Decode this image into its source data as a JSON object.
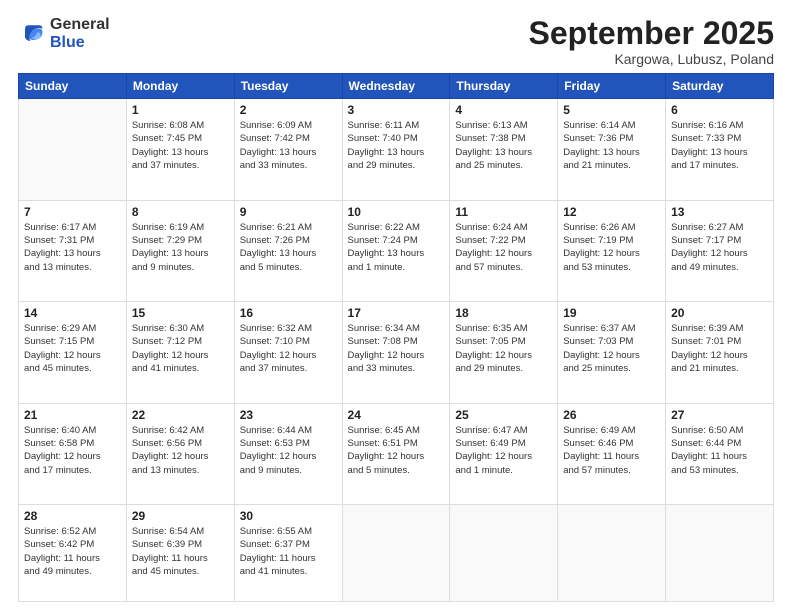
{
  "header": {
    "logo_general": "General",
    "logo_blue": "Blue",
    "month_title": "September 2025",
    "location": "Kargowa, Lubusz, Poland"
  },
  "days_of_week": [
    "Sunday",
    "Monday",
    "Tuesday",
    "Wednesday",
    "Thursday",
    "Friday",
    "Saturday"
  ],
  "weeks": [
    [
      {
        "day": "",
        "info": ""
      },
      {
        "day": "1",
        "info": "Sunrise: 6:08 AM\nSunset: 7:45 PM\nDaylight: 13 hours\nand 37 minutes."
      },
      {
        "day": "2",
        "info": "Sunrise: 6:09 AM\nSunset: 7:42 PM\nDaylight: 13 hours\nand 33 minutes."
      },
      {
        "day": "3",
        "info": "Sunrise: 6:11 AM\nSunset: 7:40 PM\nDaylight: 13 hours\nand 29 minutes."
      },
      {
        "day": "4",
        "info": "Sunrise: 6:13 AM\nSunset: 7:38 PM\nDaylight: 13 hours\nand 25 minutes."
      },
      {
        "day": "5",
        "info": "Sunrise: 6:14 AM\nSunset: 7:36 PM\nDaylight: 13 hours\nand 21 minutes."
      },
      {
        "day": "6",
        "info": "Sunrise: 6:16 AM\nSunset: 7:33 PM\nDaylight: 13 hours\nand 17 minutes."
      }
    ],
    [
      {
        "day": "7",
        "info": "Sunrise: 6:17 AM\nSunset: 7:31 PM\nDaylight: 13 hours\nand 13 minutes."
      },
      {
        "day": "8",
        "info": "Sunrise: 6:19 AM\nSunset: 7:29 PM\nDaylight: 13 hours\nand 9 minutes."
      },
      {
        "day": "9",
        "info": "Sunrise: 6:21 AM\nSunset: 7:26 PM\nDaylight: 13 hours\nand 5 minutes."
      },
      {
        "day": "10",
        "info": "Sunrise: 6:22 AM\nSunset: 7:24 PM\nDaylight: 13 hours\nand 1 minute."
      },
      {
        "day": "11",
        "info": "Sunrise: 6:24 AM\nSunset: 7:22 PM\nDaylight: 12 hours\nand 57 minutes."
      },
      {
        "day": "12",
        "info": "Sunrise: 6:26 AM\nSunset: 7:19 PM\nDaylight: 12 hours\nand 53 minutes."
      },
      {
        "day": "13",
        "info": "Sunrise: 6:27 AM\nSunset: 7:17 PM\nDaylight: 12 hours\nand 49 minutes."
      }
    ],
    [
      {
        "day": "14",
        "info": "Sunrise: 6:29 AM\nSunset: 7:15 PM\nDaylight: 12 hours\nand 45 minutes."
      },
      {
        "day": "15",
        "info": "Sunrise: 6:30 AM\nSunset: 7:12 PM\nDaylight: 12 hours\nand 41 minutes."
      },
      {
        "day": "16",
        "info": "Sunrise: 6:32 AM\nSunset: 7:10 PM\nDaylight: 12 hours\nand 37 minutes."
      },
      {
        "day": "17",
        "info": "Sunrise: 6:34 AM\nSunset: 7:08 PM\nDaylight: 12 hours\nand 33 minutes."
      },
      {
        "day": "18",
        "info": "Sunrise: 6:35 AM\nSunset: 7:05 PM\nDaylight: 12 hours\nand 29 minutes."
      },
      {
        "day": "19",
        "info": "Sunrise: 6:37 AM\nSunset: 7:03 PM\nDaylight: 12 hours\nand 25 minutes."
      },
      {
        "day": "20",
        "info": "Sunrise: 6:39 AM\nSunset: 7:01 PM\nDaylight: 12 hours\nand 21 minutes."
      }
    ],
    [
      {
        "day": "21",
        "info": "Sunrise: 6:40 AM\nSunset: 6:58 PM\nDaylight: 12 hours\nand 17 minutes."
      },
      {
        "day": "22",
        "info": "Sunrise: 6:42 AM\nSunset: 6:56 PM\nDaylight: 12 hours\nand 13 minutes."
      },
      {
        "day": "23",
        "info": "Sunrise: 6:44 AM\nSunset: 6:53 PM\nDaylight: 12 hours\nand 9 minutes."
      },
      {
        "day": "24",
        "info": "Sunrise: 6:45 AM\nSunset: 6:51 PM\nDaylight: 12 hours\nand 5 minutes."
      },
      {
        "day": "25",
        "info": "Sunrise: 6:47 AM\nSunset: 6:49 PM\nDaylight: 12 hours\nand 1 minute."
      },
      {
        "day": "26",
        "info": "Sunrise: 6:49 AM\nSunset: 6:46 PM\nDaylight: 11 hours\nand 57 minutes."
      },
      {
        "day": "27",
        "info": "Sunrise: 6:50 AM\nSunset: 6:44 PM\nDaylight: 11 hours\nand 53 minutes."
      }
    ],
    [
      {
        "day": "28",
        "info": "Sunrise: 6:52 AM\nSunset: 6:42 PM\nDaylight: 11 hours\nand 49 minutes."
      },
      {
        "day": "29",
        "info": "Sunrise: 6:54 AM\nSunset: 6:39 PM\nDaylight: 11 hours\nand 45 minutes."
      },
      {
        "day": "30",
        "info": "Sunrise: 6:55 AM\nSunset: 6:37 PM\nDaylight: 11 hours\nand 41 minutes."
      },
      {
        "day": "",
        "info": ""
      },
      {
        "day": "",
        "info": ""
      },
      {
        "day": "",
        "info": ""
      },
      {
        "day": "",
        "info": ""
      }
    ]
  ]
}
